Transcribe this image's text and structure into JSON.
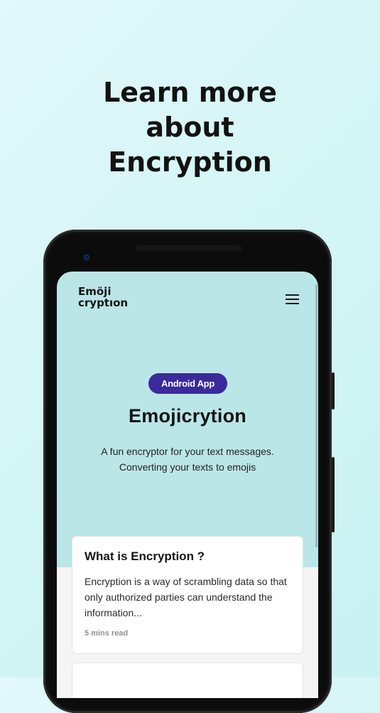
{
  "promo": {
    "headline": "Learn more\nabout\nEncryption"
  },
  "app": {
    "logo": "Emöji\ncryptıon",
    "menu_icon": "hamburger-menu-icon",
    "badge": "Android App",
    "title": "Emojicrytion",
    "description": "A fun encryptor for your text messages.\nConverting your texts to emojis",
    "colors": {
      "hero_bg": "#bae6e8",
      "badge_bg": "#3b2a9b",
      "page_bg": "#f4f4f4"
    }
  },
  "articles": [
    {
      "title": "What is Encryption ?",
      "excerpt": "Encryption is a way of scrambling data so that only authorized parties can understand the information...",
      "meta": "5 mins read"
    }
  ]
}
